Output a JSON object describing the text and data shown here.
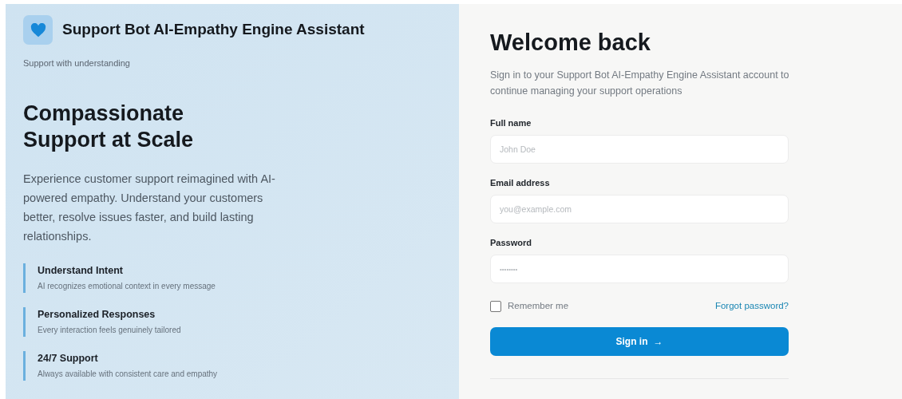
{
  "brand": {
    "name": "Support Bot AI-Empathy Engine Assistant",
    "tagline": "Support with understanding"
  },
  "hero": {
    "title_lines": [
      "Compassionate",
      "Support at Scale"
    ],
    "description": "Experience customer support reimagined with AI-powered empathy. Understand your customers better, resolve issues faster, and build lasting relationships."
  },
  "features": [
    {
      "title": "Understand Intent",
      "description": "AI recognizes emotional context in every message"
    },
    {
      "title": "Personalized Responses",
      "description": "Every interaction feels genuinely tailored"
    },
    {
      "title": "24/7 Support",
      "description": "Always available with consistent care and empathy"
    }
  ],
  "form": {
    "title": "Welcome back",
    "subtitle": "Sign in to your Support Bot AI-Empathy Engine Assistant account to continue managing your support operations",
    "fields": [
      {
        "label": "Full name",
        "placeholder": "John Doe",
        "kind": "text"
      },
      {
        "label": "Email address",
        "placeholder": "you@example.com",
        "kind": "email"
      },
      {
        "label": "Password",
        "placeholder": "••••••••",
        "kind": "password"
      }
    ],
    "remember": {
      "label": "Remember me",
      "checked": false
    },
    "forgot_link": "Forgot password?",
    "submit": {
      "label": "Sign in",
      "arrow": "→"
    }
  }
}
